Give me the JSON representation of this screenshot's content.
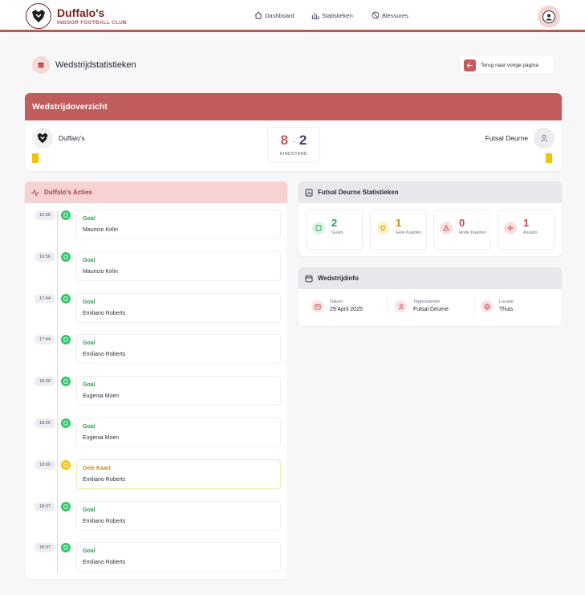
{
  "nav": {
    "brand_name": "Duffalo's",
    "brand_subtitle": "INDOOR FOOTBALL CLUB",
    "links": [
      "Dashboard",
      "Statistieken",
      "Blessures"
    ]
  },
  "page": {
    "title": "Wedstrijdstatistieken",
    "back_label": "Terug naar vorige pagina"
  },
  "overview": {
    "heading": "Wedstrijdoverzicht",
    "home_team": "Duffalo's",
    "away_team": "Futsal Deurne",
    "home_score": "8",
    "separator": "-",
    "away_score": "2",
    "score_label": "EINDSTAND"
  },
  "actions": {
    "heading": "Duffalo's Acties",
    "events": [
      {
        "time": "16:56",
        "type": "Goal",
        "player": "Mauricio Kirlin",
        "kind": "goal"
      },
      {
        "time": "16:56",
        "type": "Goal",
        "player": "Mauricio Kirlin",
        "kind": "goal"
      },
      {
        "time": "17:44",
        "type": "Goal",
        "player": "Emiliano Roberts",
        "kind": "goal"
      },
      {
        "time": "17:44",
        "type": "Goal",
        "player": "Emiliano Roberts",
        "kind": "goal"
      },
      {
        "time": "18:00",
        "type": "Goal",
        "player": "Eugenia Moen",
        "kind": "goal"
      },
      {
        "time": "18:00",
        "type": "Goal",
        "player": "Eugenia Moen",
        "kind": "goal"
      },
      {
        "time": "18:00",
        "type": "Gele Kaart",
        "player": "Emiliano Roberts",
        "kind": "yellow"
      },
      {
        "time": "18:07",
        "type": "Goal",
        "player": "Emiliano Roberts",
        "kind": "goal"
      },
      {
        "time": "18:07",
        "type": "Goal",
        "player": "Emiliano Roberts",
        "kind": "goal"
      }
    ]
  },
  "opponent_stats": {
    "heading": "Futsal Deurne Statistieken",
    "items": [
      {
        "value": "2",
        "label": "Goals",
        "color": "#2e9e55",
        "bg": "#dcf5e4",
        "icon": "goal-icon"
      },
      {
        "value": "1",
        "label": "Gele Kaarten",
        "color": "#c98a10",
        "bg": "#fdf1c6",
        "icon": "yellow-card-icon"
      },
      {
        "value": "0",
        "label": "Rode Kaarten",
        "color": "#c84a4a",
        "bg": "#fbe0e0",
        "icon": "red-card-icon"
      },
      {
        "value": "1",
        "label": "Assists",
        "color": "#c84a4a",
        "bg": "#fbe0e0",
        "icon": "assist-icon"
      }
    ]
  },
  "match_info": {
    "heading": "Wedstrijdinfo",
    "date_label": "Datum",
    "date_value": "29 April 2025",
    "opponent_label": "Tegenstander",
    "opponent_value": "Futsal Deurne",
    "location_label": "Locatie",
    "location_value": "Thuis"
  }
}
